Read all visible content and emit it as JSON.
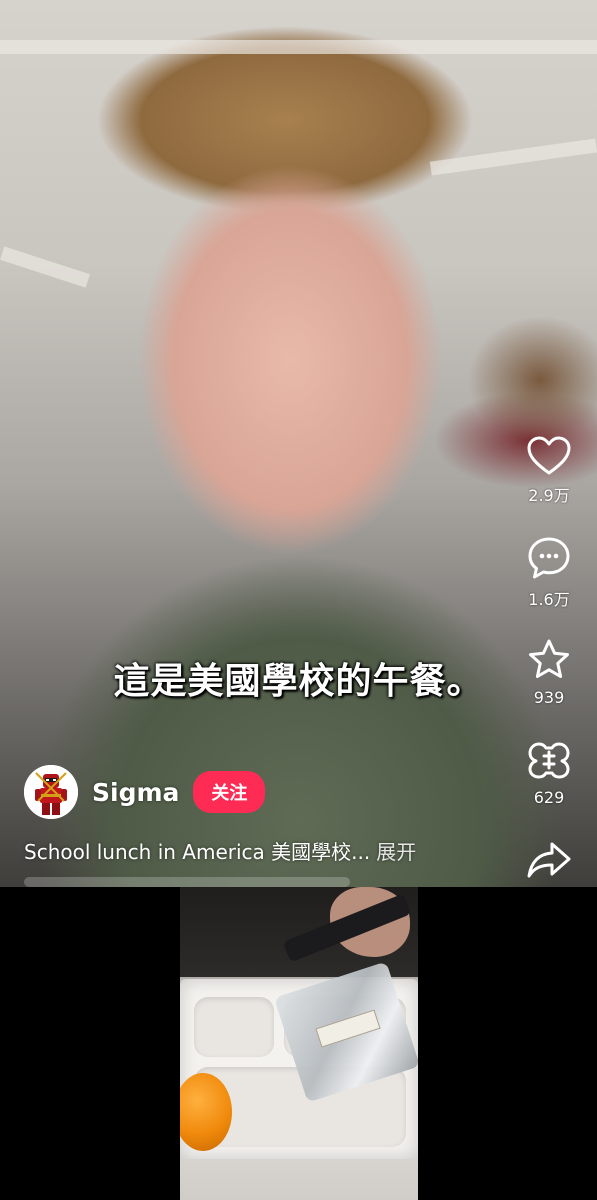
{
  "video": {
    "subtitle": "這是美國學校的午餐。",
    "author": {
      "name": "Sigma",
      "follow_label": "关注"
    },
    "description": "School lunch in America 美國學校...",
    "expand_label": "展开"
  },
  "actions": {
    "like": {
      "icon": "heart-icon",
      "count": "2.9万"
    },
    "comment": {
      "icon": "comment-bubble-icon",
      "count": "1.6万"
    },
    "favorite": {
      "icon": "star-icon",
      "count": "939"
    },
    "remix": {
      "icon": "remix-icon",
      "count": "629"
    },
    "share": {
      "icon": "share-arrow-icon"
    }
  },
  "colors": {
    "follow_button": "#fe2c55",
    "text": "#ffffff",
    "background": "#000000"
  }
}
